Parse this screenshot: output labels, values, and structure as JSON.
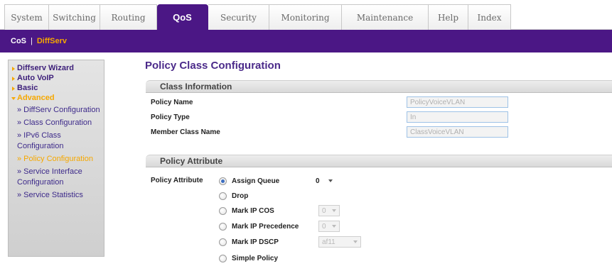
{
  "tabs": [
    {
      "label": "System"
    },
    {
      "label": "Switching"
    },
    {
      "label": "Routing"
    },
    {
      "label": "QoS"
    },
    {
      "label": "Security"
    },
    {
      "label": "Monitoring"
    },
    {
      "label": "Maintenance"
    },
    {
      "label": "Help"
    },
    {
      "label": "Index"
    }
  ],
  "subnav": {
    "cos": "CoS",
    "separator": "|",
    "diffserv": "DiffServ"
  },
  "leftnav": {
    "diffserv_wizard": "Diffserv Wizard",
    "auto_voip": "Auto VoIP",
    "basic": "Basic",
    "advanced": "Advanced",
    "items": [
      {
        "label": "» DiffServ Configuration"
      },
      {
        "label": "» Class Configuration"
      },
      {
        "label": "» IPv6 Class Configuration"
      },
      {
        "label": "» Policy Configuration"
      },
      {
        "label": "» Service Interface Configuration"
      },
      {
        "label": "» Service Statistics"
      }
    ]
  },
  "page": {
    "title": "Policy Class Configuration"
  },
  "class_info": {
    "header": "Class Information",
    "policy_name_label": "Policy Name",
    "policy_name_value": "PolicyVoiceVLAN",
    "policy_type_label": "Policy Type",
    "policy_type_value": "In",
    "member_class_label": "Member Class Name",
    "member_class_value": "ClassVoiceVLAN"
  },
  "policy_attr": {
    "header": "Policy Attribute",
    "label": "Policy Attribute",
    "options": {
      "assign_queue": "Assign Queue",
      "drop": "Drop",
      "mark_ip_cos": "Mark IP COS",
      "mark_ip_precedence": "Mark IP Precedence",
      "mark_ip_dscp": "Mark IP DSCP",
      "simple_policy": "Simple Policy"
    },
    "assign_queue_value": "0",
    "mark_ip_cos_value": "0",
    "mark_ip_precedence_value": "0",
    "mark_ip_dscp_value": "af11"
  },
  "colors": {
    "brand_purple": "#4b1785",
    "accent_orange": "#f6a800"
  }
}
